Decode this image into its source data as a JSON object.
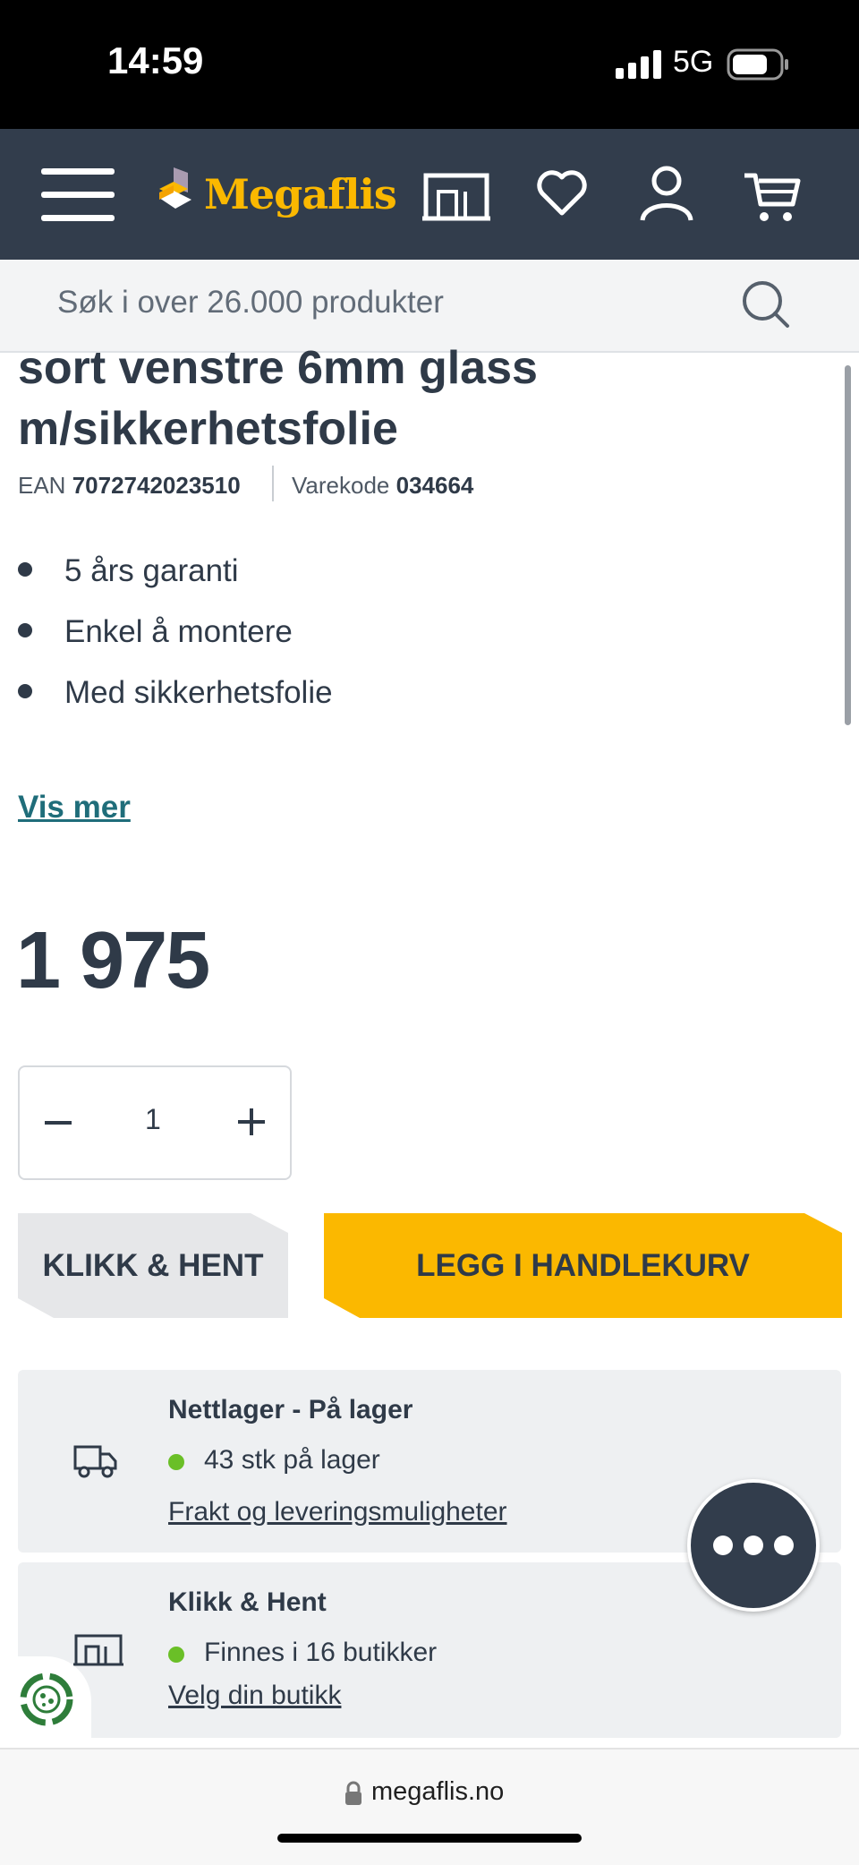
{
  "status_bar": {
    "time": "14:59",
    "network": "5G"
  },
  "header": {
    "logo_text": "Megaflis",
    "icons": [
      "menu-icon",
      "store-icon",
      "heart-icon",
      "user-icon",
      "cart-icon"
    ]
  },
  "search": {
    "placeholder": "Søk i over 26.000 produkter"
  },
  "product": {
    "title_line1": "sort venstre 6mm glass",
    "title_line2": "m/sikkerhetsfolie",
    "ean_label": "EAN",
    "ean": "7072742023510",
    "code_label": "Varekode",
    "code": "034664",
    "features": [
      "5 års garanti",
      "Enkel å montere",
      "Med sikkerhetsfolie"
    ],
    "show_more": "Vis mer",
    "price": "1 975",
    "quantity": "1"
  },
  "actions": {
    "click_collect": "KLIKK & HENT",
    "add_to_cart": "LEGG I HANDLEKURV"
  },
  "availability": {
    "online": {
      "title": "Nettlager - På lager",
      "status": "43 stk på lager",
      "link": "Frakt og leveringsmuligheter"
    },
    "store": {
      "title": "Klikk & Hent",
      "status": "Finnes i 16 butikker",
      "link": "Velg din butikk"
    }
  },
  "browser": {
    "url": "megaflis.no"
  },
  "colors": {
    "header": "#323d4c",
    "accent": "#fbb800",
    "link": "#1f6d7a",
    "in_stock": "#6abf27"
  }
}
